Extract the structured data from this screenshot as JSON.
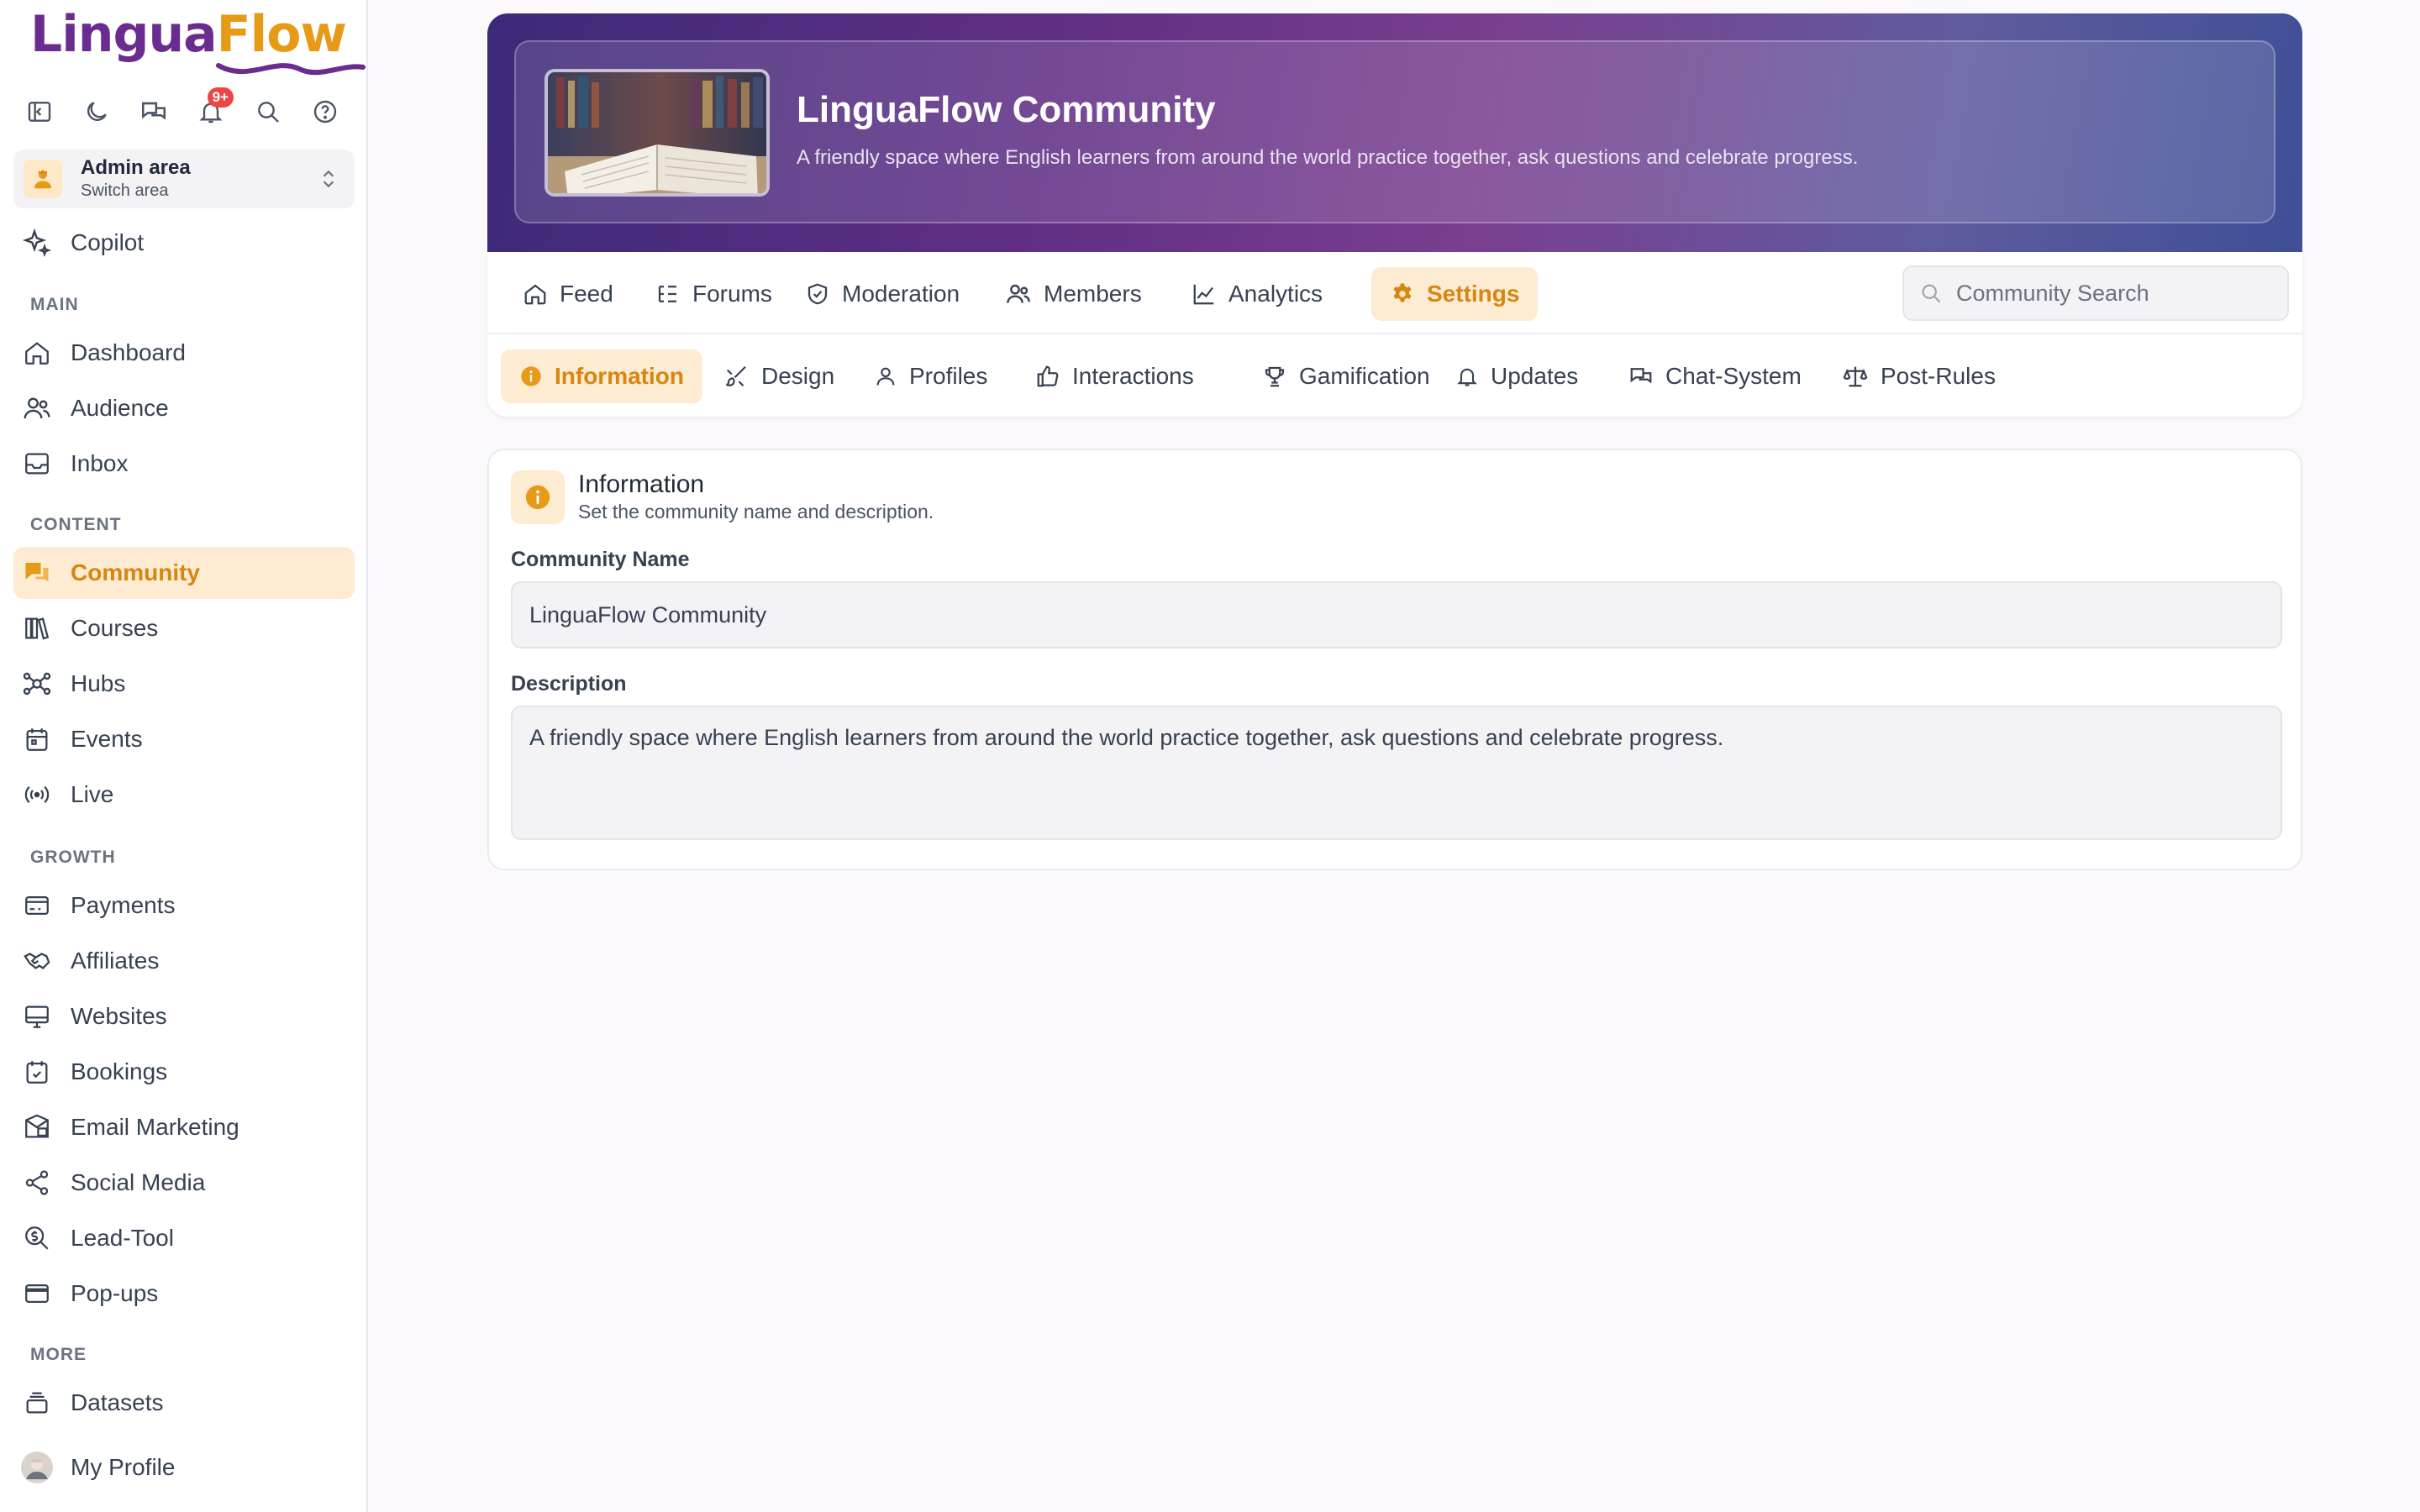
{
  "brand": {
    "part1": "Lingua",
    "part2": "Flow"
  },
  "notifications": {
    "badge": "9+"
  },
  "area": {
    "title": "Admin area",
    "subtitle": "Switch area"
  },
  "sidebar": {
    "copilot": "Copilot",
    "sections": {
      "main": "MAIN",
      "content": "CONTENT",
      "growth": "GROWTH",
      "more": "MORE"
    },
    "items": {
      "dashboard": "Dashboard",
      "audience": "Audience",
      "inbox": "Inbox",
      "community": "Community",
      "courses": "Courses",
      "hubs": "Hubs",
      "events": "Events",
      "live": "Live",
      "payments": "Payments",
      "affiliates": "Affiliates",
      "websites": "Websites",
      "bookings": "Bookings",
      "email_marketing": "Email Marketing",
      "social_media": "Social Media",
      "lead_tool": "Lead-Tool",
      "popups": "Pop-ups",
      "datasets": "Datasets"
    },
    "profile": "My Profile"
  },
  "hero": {
    "title": "LinguaFlow Community",
    "description": "A friendly space where English learners from around the world practice together, ask questions and celebrate progress."
  },
  "tabs": {
    "feed": "Feed",
    "forums": "Forums",
    "moderation": "Moderation",
    "members": "Members",
    "analytics": "Analytics",
    "settings": "Settings"
  },
  "search": {
    "placeholder": "Community Search"
  },
  "settings_tabs": {
    "information": "Information",
    "design": "Design",
    "profiles": "Profiles",
    "interactions": "Interactions",
    "gamification": "Gamification",
    "updates": "Updates",
    "chat_system": "Chat-System",
    "post_rules": "Post-Rules"
  },
  "info_card": {
    "title": "Information",
    "subtitle": "Set the community name and description.",
    "name_label": "Community Name",
    "name_value": "LinguaFlow Community",
    "description_label": "Description",
    "description_value": "A friendly space where English learners from around the world practice together, ask questions and celebrate progress."
  },
  "colors": {
    "accent": "#d8860f",
    "accent_bg": "#fdebd2",
    "brand_purple": "#6b2c8f",
    "brand_orange": "#e69a17"
  }
}
